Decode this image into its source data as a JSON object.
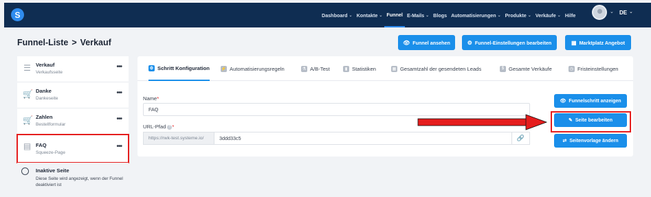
{
  "app": {
    "logo_letter": "S"
  },
  "nav": {
    "items": [
      {
        "label": "Dashboard",
        "chev": "⌄"
      },
      {
        "label": "Kontakte",
        "chev": "⌄"
      },
      {
        "label": "Funnel",
        "chev": ""
      },
      {
        "label": "E-Mails",
        "chev": "⌄"
      },
      {
        "label": "Blogs",
        "chev": ""
      },
      {
        "label": "Automatisierungen",
        "chev": "⌄"
      },
      {
        "label": "Produkte",
        "chev": "⌄"
      },
      {
        "label": "Verkäufe",
        "chev": "⌄"
      },
      {
        "label": "Hilfe",
        "chev": ""
      }
    ],
    "active_index": 2,
    "language": "DE"
  },
  "header": {
    "breadcrumb_root": "Funnel-Liste",
    "breadcrumb_sep": ">",
    "breadcrumb_current": "Verkauf",
    "btn_view_funnel": "Funnel ansehen",
    "btn_edit_settings": "Funnel-Einstellungen bearbeiten",
    "btn_marketplace": "Marktplatz Angebot"
  },
  "sidebar": {
    "items": [
      {
        "name": "Verkauf",
        "sub": "Verkaufsseite",
        "icon": "☰"
      },
      {
        "name": "Danke",
        "sub": "Dankeseite",
        "icon": "🛒"
      },
      {
        "name": "Zahlen",
        "sub": "Bestellformular",
        "icon": "🛒"
      },
      {
        "name": "FAQ",
        "sub": "Squeeze-Page",
        "icon": "▤"
      }
    ],
    "dots": "•••",
    "inactive_title": "Inaktive Seite",
    "inactive_desc": "Diese Seite wird angezeigt, wenn der Funnel deaktiviert ist"
  },
  "tabs": [
    {
      "label": "Schritt Konfiguration",
      "icon": "⚙"
    },
    {
      "label": "Automatisierungsregeln",
      "icon": "⚡"
    },
    {
      "label": "A/B-Test",
      "icon": "⚗"
    },
    {
      "label": "Statistiken",
      "icon": "▮"
    },
    {
      "label": "Gesamtzahl der gesendeten Leads",
      "icon": "▦"
    },
    {
      "label": "Gesamte Verkäufe",
      "icon": "$"
    },
    {
      "label": "Fristeinstellungen",
      "icon": "◷"
    }
  ],
  "form": {
    "name_label": "Name",
    "name_value": "FAQ",
    "url_label": "URL-Pfad",
    "url_prefix": "https://rwk-test.systeme.io/",
    "url_value": "3ddd33c5",
    "required_mark": "*",
    "help_mark": "?"
  },
  "actions": {
    "show_step": "Funnelschritt anzeigen",
    "edit_page": "Seite bearbeiten",
    "change_template": "Seitenvorlage ändern"
  },
  "colors": {
    "accent": "#1a8fea",
    "nav_bg": "#0f2d52",
    "highlight": "#e51d1d"
  }
}
